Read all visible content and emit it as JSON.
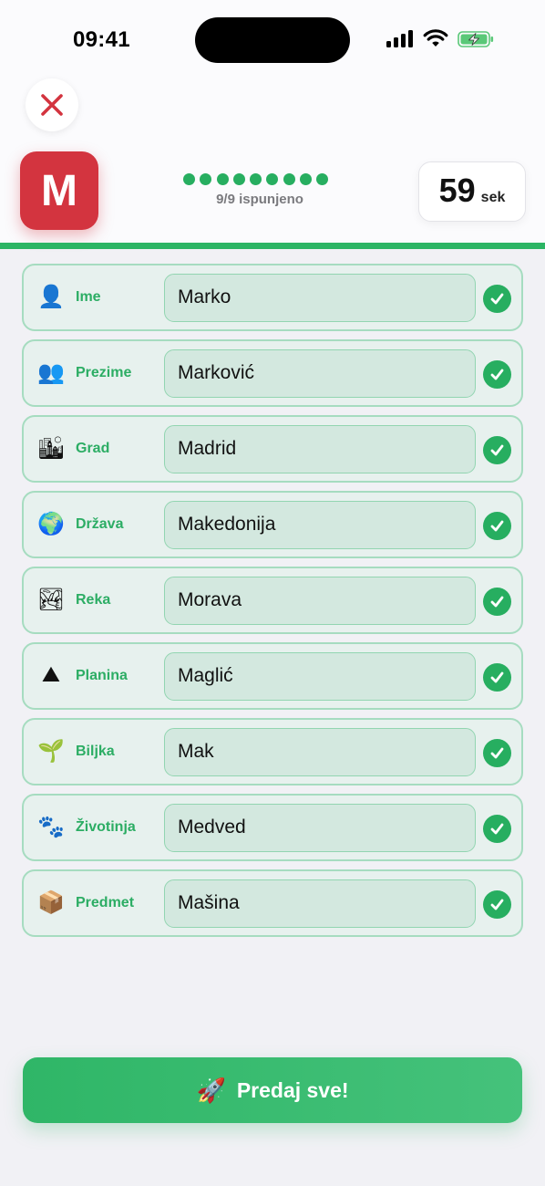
{
  "status_bar": {
    "time": "09:41"
  },
  "header": {
    "letter": "M",
    "progress": {
      "filled": 9,
      "total": 9,
      "text": "9/9 ispunjeno"
    },
    "timer": {
      "value": "59",
      "unit": "sek"
    }
  },
  "fields": [
    {
      "icon": "person-icon",
      "glyph": "👤",
      "label": "Ime",
      "value": "Marko"
    },
    {
      "icon": "people-icon",
      "glyph": "👥",
      "label": "Prezime",
      "value": "Marković"
    },
    {
      "icon": "city-icon",
      "glyph": "🏙",
      "label": "Grad",
      "value": "Madrid"
    },
    {
      "icon": "globe-icon",
      "glyph": "🌍",
      "label": "Država",
      "value": "Makedonija"
    },
    {
      "icon": "river-landscape-icon",
      "glyph": "🏞",
      "label": "Reka",
      "value": "Morava"
    },
    {
      "icon": "mountain-icon",
      "glyph": "⛰",
      "label": "Planina",
      "value": "Maglić"
    },
    {
      "icon": "seedling-icon",
      "glyph": "🌱",
      "label": "Biljka",
      "value": "Mak"
    },
    {
      "icon": "paw-prints-icon",
      "glyph": "🐾",
      "label": "Životinja",
      "value": "Medved"
    },
    {
      "icon": "package-icon",
      "glyph": "📦",
      "label": "Predmet",
      "value": "Mašina"
    }
  ],
  "submit": {
    "label": "Predaj sve!",
    "icon": "rocket-icon",
    "glyph": "🚀"
  },
  "colors": {
    "accent_green": "#2cb564",
    "badge_red": "#d3343f",
    "close_red": "#d3343f",
    "field_bg": "#e7f1ee",
    "field_border": "#a6dcc0"
  }
}
